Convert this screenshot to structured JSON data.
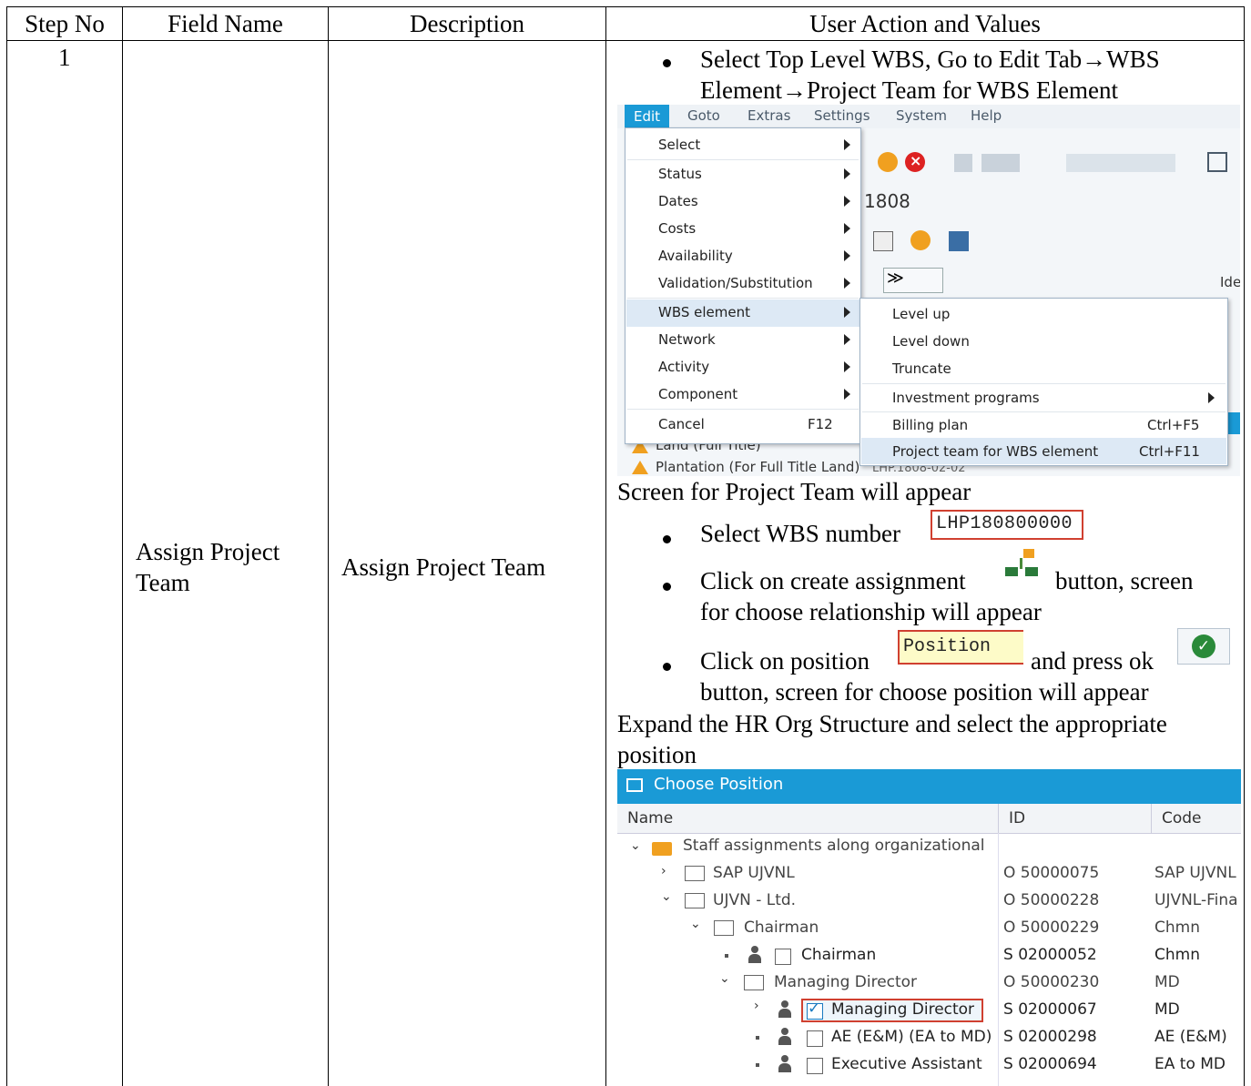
{
  "table": {
    "headers": [
      "Step No",
      "Field Name",
      "Description",
      "User Action and Values"
    ],
    "step_no": "1",
    "field_name_line1": "Assign Project",
    "field_name_line2": "Team",
    "description": "Assign Project Team"
  },
  "actions": {
    "bullet1_line1": "Select Top Level WBS, Go to Edit Tab→WBS",
    "bullet1_line2": "Element→Project Team for WBS Element",
    "screen_team": "Screen for Project Team will appear",
    "bullet2_text": "Select WBS number",
    "wbs_number": "LHP180800000",
    "bullet3_line1a": "Click on create assignment",
    "bullet3_line1b": "button, screen",
    "bullet3_line2": "for choose relationship will appear",
    "bullet4_line1a": "Click on position",
    "position_field": "Position",
    "bullet4_line1b": "and press ok",
    "bullet4_line2": "button, screen for choose position will appear",
    "expand_line1": "Expand the HR Org Structure and select the appropriate",
    "expand_line2": "position"
  },
  "sap_menu": {
    "menubar": [
      "Edit",
      "Goto",
      "Extras",
      "Settings",
      "System",
      "Help"
    ],
    "edit_items": [
      "Select",
      "Status",
      "Dates",
      "Costs",
      "Availability",
      "Validation/Substitution",
      "WBS element",
      "Network",
      "Activity",
      "Component",
      "Cancel"
    ],
    "cancel_shortcut": "F12",
    "wbs_submenu": [
      "Level up",
      "Level down",
      "Truncate",
      "Investment programs",
      "Billing plan",
      "Project team for WBS element"
    ],
    "billing_shortcut": "Ctrl+F5",
    "project_team_shortcut": "Ctrl+F11",
    "bg_project_num": "1808",
    "bg_ide": "Ide",
    "bg_row1": "Land (Full Title)",
    "bg_row2": "Plantation (For Full Title Land)",
    "bg_row2_code": "LHP.1808-02-02"
  },
  "choose_position": {
    "title": "Choose Position",
    "columns": [
      "Name",
      "ID",
      "Code"
    ],
    "rows": [
      {
        "name": "Staff assignments along organizational",
        "id": "",
        "code": ""
      },
      {
        "name": "SAP UJVNL",
        "id": "O  50000075",
        "code": "SAP UJVNL"
      },
      {
        "name": "UJVN - Ltd.",
        "id": "O  50000228",
        "code": "UJVNL-Fina"
      },
      {
        "name": "Chairman",
        "id": "O  50000229",
        "code": "Chmn"
      },
      {
        "name": "Chairman",
        "id": "S  02000052",
        "code": "Chmn"
      },
      {
        "name": "Managing Director",
        "id": "O  50000230",
        "code": "MD"
      },
      {
        "name": "Managing Director",
        "id": "S  02000067",
        "code": "MD"
      },
      {
        "name": "AE (E&M) (EA to MD)",
        "id": "S  02000298",
        "code": "AE (E&M)"
      },
      {
        "name": "Executive Assistant",
        "id": "S  02000694",
        "code": "EA to MD"
      }
    ]
  },
  "colors": {
    "sap_blue": "#1a9ad6",
    "menu_highlight": "#dde9f5",
    "position_field_bg": "#fdfbc8"
  }
}
